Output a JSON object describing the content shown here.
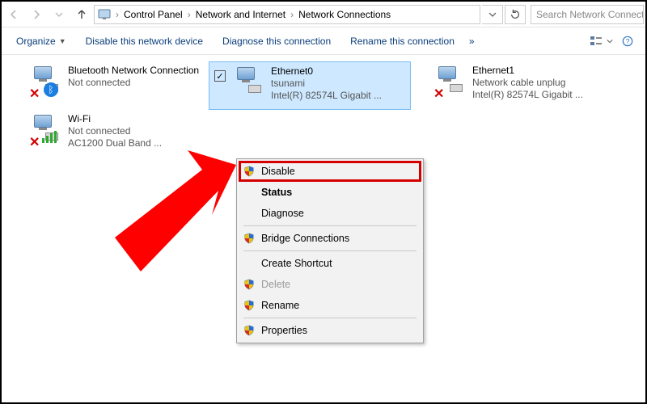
{
  "addressbar": {
    "icon_label": "control-panel-icon",
    "crumbs": [
      "Control Panel",
      "Network and Internet",
      "Network Connections"
    ],
    "search_placeholder": "Search Network Connecti"
  },
  "commandbar": {
    "organize": "Organize",
    "disable": "Disable this network device",
    "diagnose": "Diagnose this connection",
    "rename": "Rename this connection",
    "overflow": "»"
  },
  "connections": [
    {
      "id": "bt",
      "name": "Bluetooth Network Connection",
      "status": "Not connected",
      "device": "",
      "selected": false,
      "icon": "bluetooth",
      "error": true
    },
    {
      "id": "eth0",
      "name": "Ethernet0",
      "status": "tsunami",
      "device": "Intel(R) 82574L Gigabit ...",
      "selected": true,
      "icon": "ethernet",
      "error": false
    },
    {
      "id": "eth1",
      "name": "Ethernet1",
      "status": "Network cable unplug",
      "device": "Intel(R) 82574L Gigabit ...",
      "selected": false,
      "icon": "ethernet",
      "error": true
    },
    {
      "id": "wifi",
      "name": "Wi-Fi",
      "status": "Not connected",
      "device": "AC1200  Dual Band ...",
      "selected": false,
      "icon": "wifi",
      "error": true
    }
  ],
  "context_menu": {
    "items": [
      {
        "label": "Disable",
        "shield": true,
        "bold": false,
        "highlight": true
      },
      {
        "label": "Status",
        "shield": false,
        "bold": true
      },
      {
        "label": "Diagnose",
        "shield": false,
        "bold": false
      },
      {
        "sep": true
      },
      {
        "label": "Bridge Connections",
        "shield": true,
        "bold": false
      },
      {
        "sep": true
      },
      {
        "label": "Create Shortcut",
        "shield": false,
        "bold": false
      },
      {
        "label": "Delete",
        "shield": true,
        "bold": false,
        "disabled": true
      },
      {
        "label": "Rename",
        "shield": true,
        "bold": false
      },
      {
        "sep": true
      },
      {
        "label": "Properties",
        "shield": true,
        "bold": false
      }
    ]
  },
  "annotation": {
    "type": "arrow",
    "color": "#ff0000"
  }
}
